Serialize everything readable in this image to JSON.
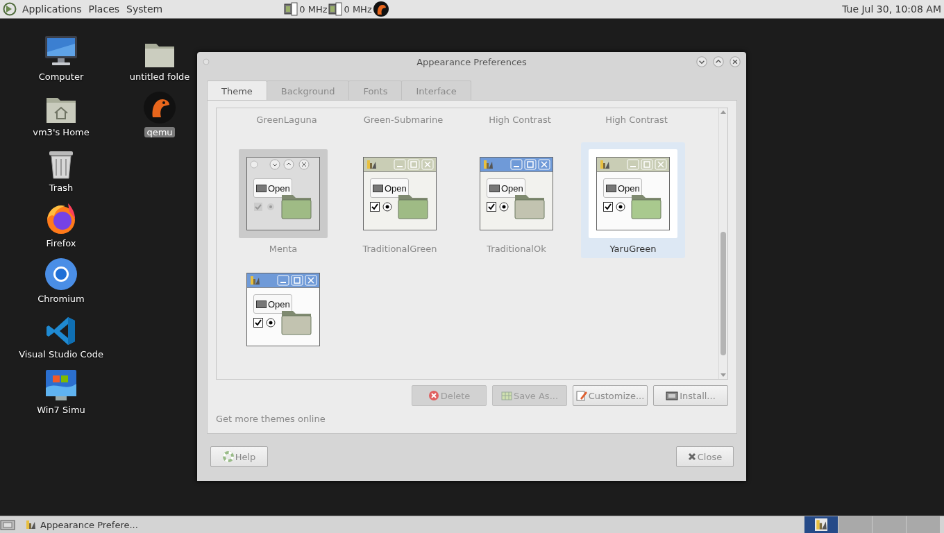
{
  "top_panel": {
    "menus": [
      "Applications",
      "Places",
      "System"
    ],
    "cpu_monitors": [
      "0 MHz",
      "0 MHz"
    ],
    "clock": "Tue Jul 30, 10:08 AM"
  },
  "desktop": {
    "columns": [
      [
        {
          "label": "Computer",
          "kind": "computer",
          "selected": false
        },
        {
          "label": "vm3's Home",
          "kind": "home",
          "selected": false
        },
        {
          "label": "Trash",
          "kind": "trash",
          "selected": false
        },
        {
          "label": "Firefox",
          "kind": "firefox",
          "selected": false
        },
        {
          "label": "Chromium",
          "kind": "chromium",
          "selected": false
        },
        {
          "label": "Visual Studio Code",
          "kind": "vscode",
          "selected": false
        },
        {
          "label": "Win7 Simu",
          "kind": "win7",
          "selected": false
        }
      ],
      [
        {
          "label": "untitled folde",
          "kind": "folder",
          "selected": false
        },
        {
          "label": "qemu",
          "kind": "qemu",
          "selected": true
        }
      ]
    ]
  },
  "window": {
    "title": "Appearance Preferences",
    "tabs": [
      {
        "label": "Theme",
        "selected": true
      },
      {
        "label": "Background",
        "selected": false
      },
      {
        "label": "Fonts",
        "selected": false
      },
      {
        "label": "Interface",
        "selected": false
      }
    ],
    "partial_row_labels": [
      "GreenLaguna",
      "Green-Submarine",
      "High Contrast",
      "High Contrast"
    ],
    "themes": [
      {
        "name": "Menta",
        "kind": "menta",
        "button_label": "Open",
        "selected": false
      },
      {
        "name": "TraditionalGreen",
        "kind": "traditional-green",
        "button_label": "Open",
        "selected": false
      },
      {
        "name": "TraditionalOk",
        "kind": "traditional-ok",
        "button_label": "Open",
        "selected": false
      },
      {
        "name": "YaruGreen",
        "kind": "yaru-green",
        "button_label": "Open",
        "selected": true
      },
      {
        "kind": "yaru-ok",
        "button_label": "Open",
        "selected": false
      }
    ],
    "actions": [
      {
        "label": "Delete",
        "kind": "delete",
        "disabled": true
      },
      {
        "label": "Save As...",
        "kind": "save",
        "disabled": true
      },
      {
        "label": "Customize...",
        "kind": "customize",
        "disabled": false
      },
      {
        "label": "Install...",
        "kind": "install",
        "disabled": false
      }
    ],
    "link": "Get more themes online",
    "buttons": [
      {
        "label": "Help",
        "kind": "help"
      },
      {
        "label": "Close",
        "kind": "close"
      }
    ]
  },
  "taskbar": {
    "tasks": [
      {
        "label": "Appearance Prefere..."
      }
    ],
    "workspaces": [
      {
        "selected": true
      },
      {
        "selected": false
      },
      {
        "selected": false
      },
      {
        "selected": false
      }
    ]
  }
}
